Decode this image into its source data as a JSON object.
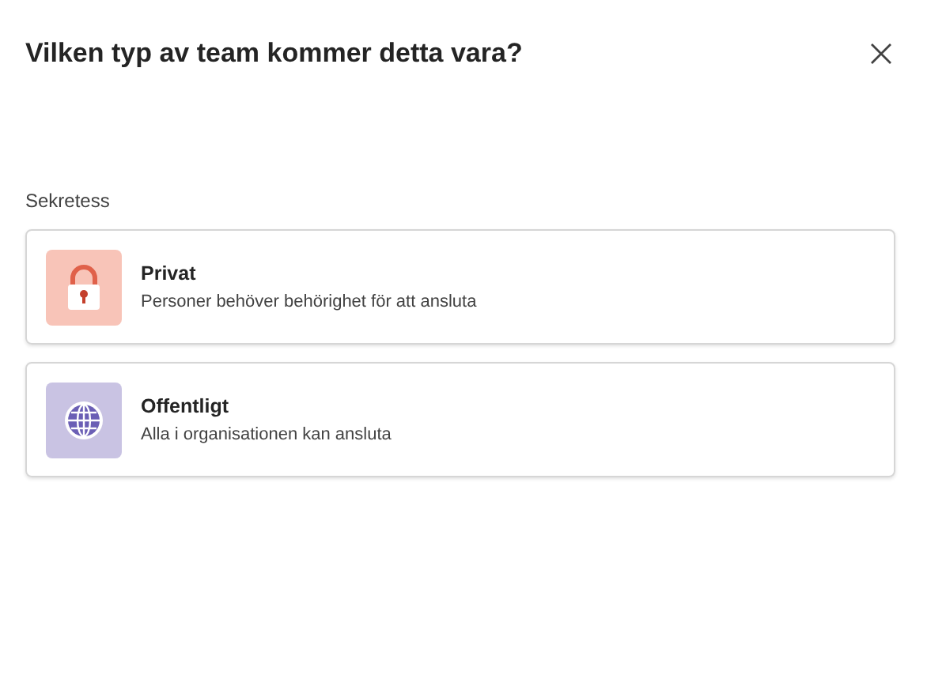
{
  "dialog": {
    "title": "Vilken typ av team kommer detta vara?"
  },
  "section_label": "Sekretess",
  "options": [
    {
      "kind": "lock",
      "color": "#f8c4b8",
      "title": "Privat",
      "description": "Personer behöver behörighet för att ansluta"
    },
    {
      "kind": "globe",
      "color": "#c9c3e3",
      "title": "Offentligt",
      "description": "Alla i organisationen kan ansluta"
    }
  ]
}
